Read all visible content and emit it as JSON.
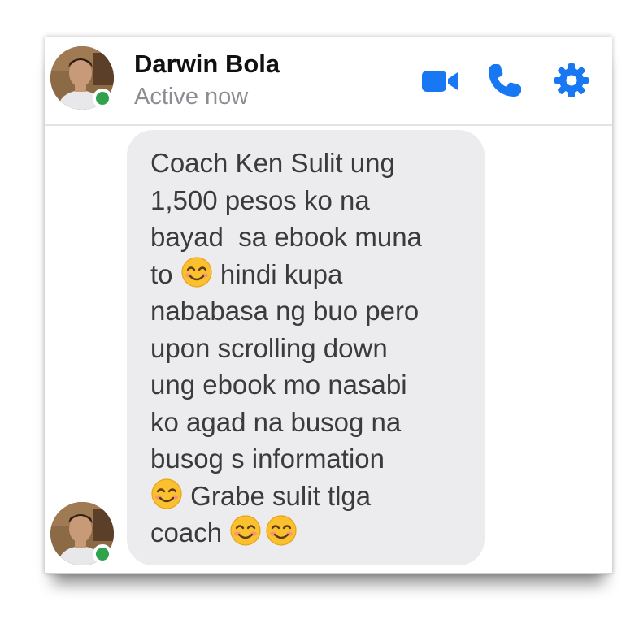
{
  "contact": {
    "name": "Darwin Bola",
    "status": "Active now",
    "presence_color": "#31a24c"
  },
  "header_actions": [
    {
      "icon": "video-camera-icon",
      "color": "#1877f2"
    },
    {
      "icon": "phone-icon",
      "color": "#1877f2"
    },
    {
      "icon": "gear-icon",
      "color": "#1877f2"
    }
  ],
  "message": {
    "lines": [
      {
        "before": "Coach Ken Sulit ung",
        "emojis": 0,
        "after": ""
      },
      {
        "before": "1,500 pesos ko na",
        "emojis": 0,
        "after": ""
      },
      {
        "before": "bayad  sa ebook muna",
        "emojis": 0,
        "after": ""
      },
      {
        "before": "to ",
        "emojis": 1,
        "after": " hindi kupa"
      },
      {
        "before": "nababasa ng buo pero",
        "emojis": 0,
        "after": ""
      },
      {
        "before": "upon scrolling down",
        "emojis": 0,
        "after": ""
      },
      {
        "before": "ung ebook mo nasabi",
        "emojis": 0,
        "after": ""
      },
      {
        "before": "ko agad na busog na",
        "emojis": 0,
        "after": ""
      },
      {
        "before": "busog s information",
        "emojis": 0,
        "after": ""
      },
      {
        "before": "",
        "emojis": 1,
        "after": " Grabe sulit tlga"
      },
      {
        "before": "coach ",
        "emojis": 2,
        "after": ""
      }
    ],
    "emoji": "smiling-face-with-smiling-eyes-icon",
    "bubble_color": "#ececef"
  }
}
